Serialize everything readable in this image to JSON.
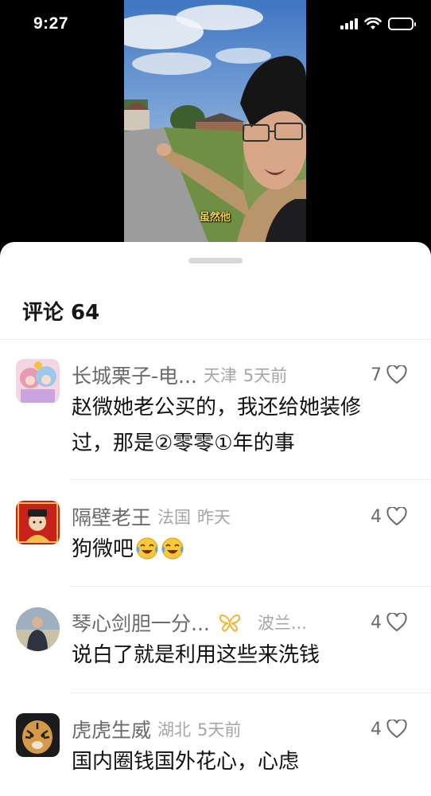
{
  "status_bar": {
    "time": "9:27",
    "battery_level": 0.95
  },
  "video": {
    "subtitle": "虽然他"
  },
  "comments_sheet": {
    "title": "评论 64",
    "comments": [
      {
        "user": "长城栗子-电...",
        "location": "天津",
        "time": "5天前",
        "likes": "7",
        "text": "赵微她老公买的，我还给她装修过，那是②零零①年的事"
      },
      {
        "user": "隔壁老王",
        "location": "法国",
        "time": "昨天",
        "likes": "4",
        "text": "狗微吧",
        "emojis": [
          "crying-laughing-emoji",
          "crying-laughing-emoji"
        ]
      },
      {
        "user": "琴心剑胆一分...",
        "location": "波兰...",
        "time": "",
        "likes": "4",
        "text": "说白了就是利用这些来洗钱",
        "badge": "butterfly-badge-icon",
        "badge_color": "#f2b43a"
      },
      {
        "user": "虎虎生威",
        "location": "湖北",
        "time": "5天前",
        "likes": "4",
        "text": "国内圈钱国外花心，心虑"
      }
    ]
  }
}
